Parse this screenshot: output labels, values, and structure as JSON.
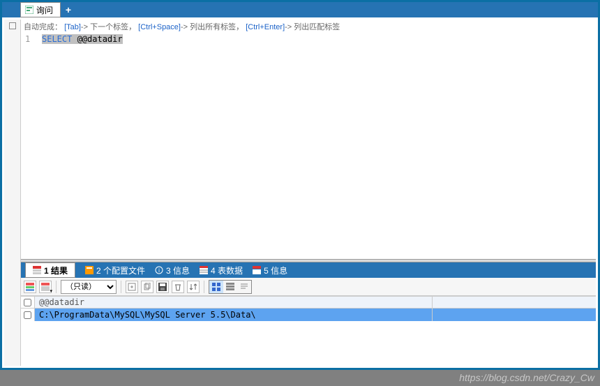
{
  "tab": {
    "title": "询问"
  },
  "hint": {
    "prefix": "自动完成：",
    "k1": "[Tab]",
    "t1": "-> 下一个标签，",
    "k2": "[Ctrl+Space]",
    "t2": "-> 列出所有标签，",
    "k3": "[Ctrl+Enter]",
    "t3": "-> 列出匹配标签"
  },
  "editor": {
    "line_no": "1",
    "keyword": "SELECT",
    "rest": " @@datadir"
  },
  "bottom_tabs": {
    "result": "1 结果",
    "profile": "2 个配置文件",
    "info3": "3 信息",
    "tabledata": "4 表数据",
    "info5": "5 信息"
  },
  "toolbar": {
    "mode": "（只读）"
  },
  "result": {
    "header": "@@datadir",
    "value": "C:\\ProgramData\\MySQL\\MySQL Server 5.5\\Data\\"
  },
  "watermark": "https://blog.csdn.net/Crazy_Cw"
}
